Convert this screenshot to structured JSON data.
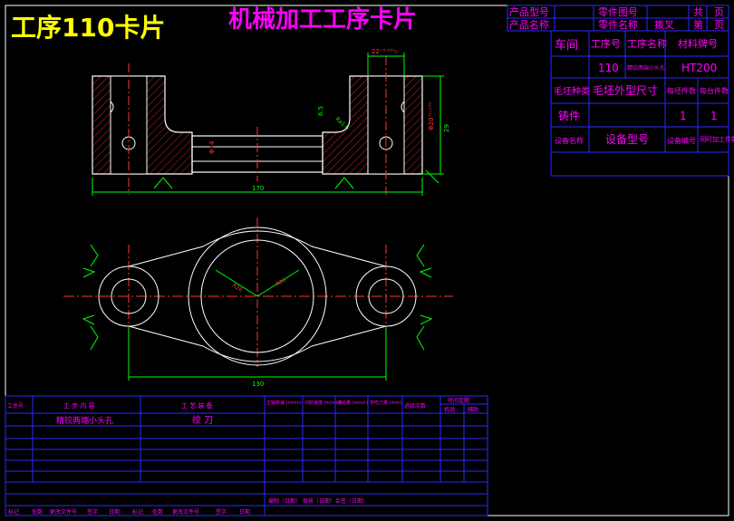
{
  "title_left": "工序110卡片",
  "title_main": "机械加工工序卡片",
  "header": {
    "product_model": "产品型号",
    "product_name": "产品名称",
    "part_drawing_no": "零件图号",
    "part_name": "零件名称",
    "part_name_value": "拨叉",
    "total": "共",
    "total_unit": "页",
    "page": "第",
    "page_unit": "页"
  },
  "info": {
    "workshop": "车间",
    "op_no": "工序号",
    "op_name": "工序名称",
    "material_grade": "材料牌号",
    "op_no_value": "110",
    "op_name_value": "精铰两端小头孔",
    "material_value": "HT200",
    "blank_type": "毛坯种类",
    "blank_size": "毛坯外型尺寸",
    "per_blank_count": "每坯件数",
    "per_unit_count": "每台件数",
    "blank_type_value": "铸件",
    "per_blank_value": "1",
    "per_unit_value": "1",
    "equip_name": "设备名称",
    "equip_model": "设备型号",
    "equip_no": "设备编号",
    "simul_count": "同时加工件数"
  },
  "drawing": {
    "dim_width_top": "170",
    "dim_width_bottom": "130",
    "dim_slot": "22⁺⁰·⁰²¹₀",
    "dim_bore": "Φ14",
    "dim_bore_right": "Φ20⁺⁰·⁰²¹",
    "dim_step": "6.5",
    "dim_depth": "29",
    "dim_r": "R26",
    "dim_r2": "R26",
    "roughness": "Ra1.6"
  },
  "process_table": {
    "headers": [
      "工步号",
      "工 步 内 容",
      "工 艺 装 备",
      "主轴转速 (r/min)",
      "切削速度 (m/min)",
      "进给量 (mm/r)",
      "背吃刀量 (mm)",
      "进给次数",
      "时间定额"
    ],
    "time_sub": [
      "机动",
      "辅助"
    ],
    "rows": [
      {
        "step": "",
        "content": "精铰两端小头孔",
        "tool": "绞 刀"
      }
    ],
    "footer_signoff": "编制（日期） 审核（日期）会签（日期）",
    "footer_marks": [
      "标记",
      "处数",
      "更改文件号",
      "签字",
      "日期",
      "标记",
      "处数",
      "更改文件号",
      "签字",
      "日期"
    ]
  }
}
